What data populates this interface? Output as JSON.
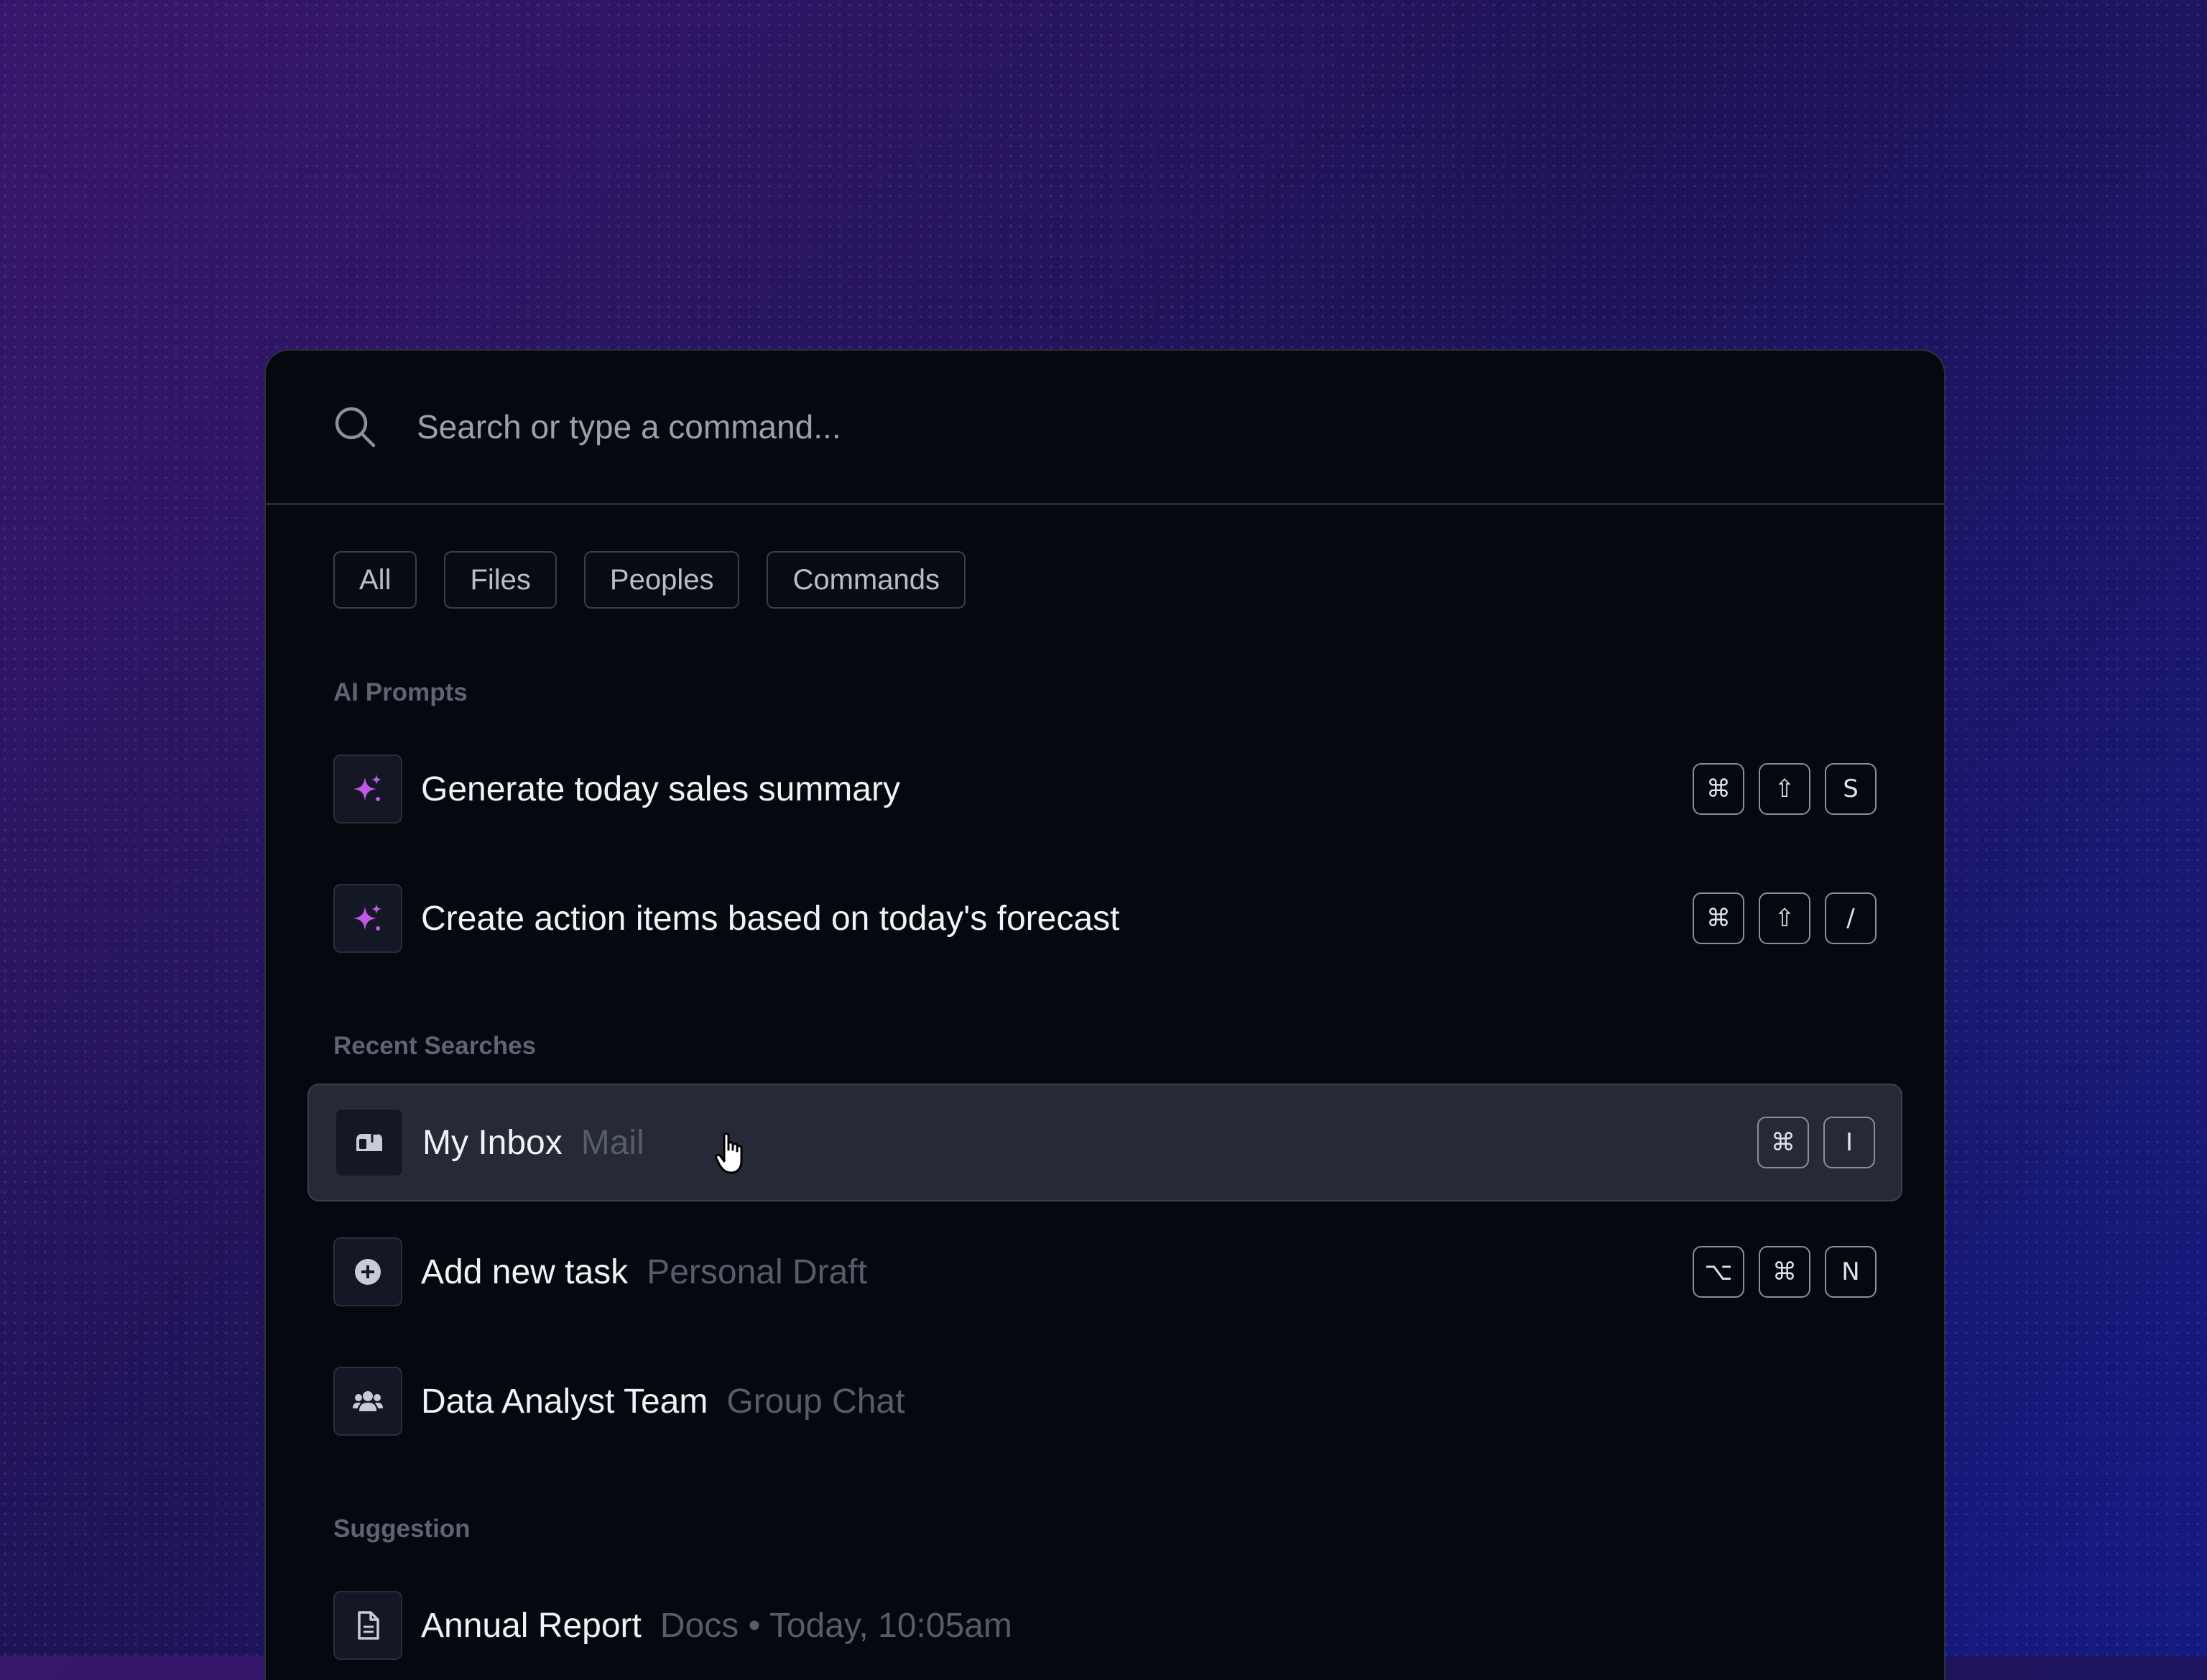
{
  "search": {
    "placeholder": "Search or type a command..."
  },
  "filters": [
    "All",
    "Files",
    "Peoples",
    "Commands"
  ],
  "sections": {
    "ai_prompts": {
      "label": "AI Prompts",
      "items": [
        {
          "title": "Generate today sales summary",
          "icon": "sparkle-icon",
          "keys": [
            "⌘",
            "⇧",
            "S"
          ]
        },
        {
          "title": "Create action items based on today's forecast",
          "icon": "sparkle-icon",
          "keys": [
            "⌘",
            "⇧",
            "/"
          ]
        }
      ]
    },
    "recent": {
      "label": "Recent Searches",
      "items": [
        {
          "title": "My Inbox",
          "subtitle": "Mail",
          "icon": "mailbox-icon",
          "keys": [
            "⌘",
            "I"
          ],
          "active": true
        },
        {
          "title": "Add new task",
          "subtitle": "Personal Draft",
          "icon": "plus-circle-icon",
          "keys": [
            "⌥",
            "⌘",
            "N"
          ]
        },
        {
          "title": "Data Analyst Team",
          "subtitle": "Group Chat",
          "icon": "group-icon",
          "keys": []
        }
      ]
    },
    "suggestion": {
      "label": "Suggestion",
      "items": [
        {
          "title": "Annual Report",
          "subtitle": "Docs • Today, 10:05am",
          "icon": "document-icon",
          "keys": []
        }
      ]
    }
  },
  "colors": {
    "accent": "#c158e6",
    "background": "#05080f",
    "active_row": "#262a37"
  }
}
